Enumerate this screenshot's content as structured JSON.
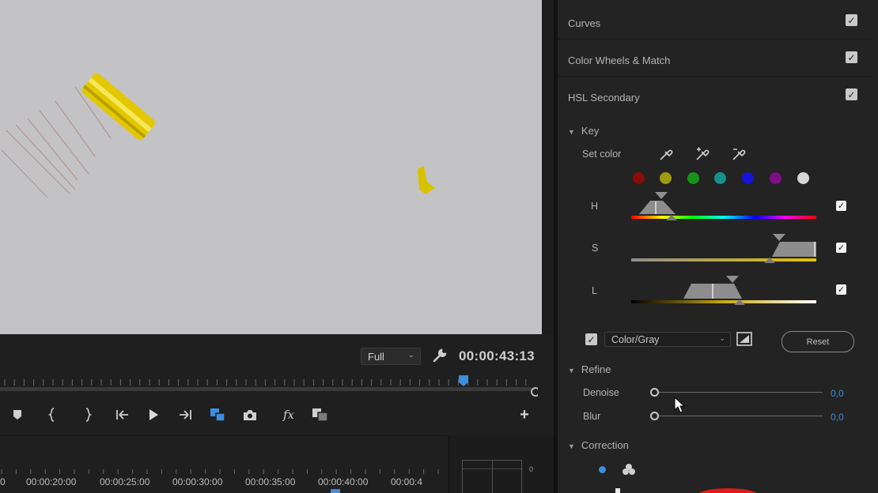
{
  "monitor": {
    "zoom": {
      "selected": "Full"
    },
    "timecode": "00:00:43:13"
  },
  "transport": {
    "buttons": [
      {
        "name": "add-marker-button",
        "icon": "marker-icon"
      },
      {
        "name": "mark-in-button",
        "icon": "mark-in-icon"
      },
      {
        "name": "mark-out-button",
        "icon": "mark-out-icon"
      },
      {
        "name": "go-to-in-button",
        "icon": "go-to-in-icon"
      },
      {
        "name": "play-button",
        "icon": "play-icon"
      },
      {
        "name": "go-to-out-button",
        "icon": "go-to-out-icon"
      },
      {
        "name": "comparison-view-button",
        "icon": "comparison-icon"
      },
      {
        "name": "export-frame-button",
        "icon": "camera-icon"
      },
      {
        "name": "fx-button",
        "icon": "fx-icon"
      },
      {
        "name": "multicam-button",
        "icon": "multicam-icon"
      },
      {
        "name": "add-button",
        "icon": "plus-icon"
      }
    ],
    "fx_label": "fx",
    "plus_label": "+"
  },
  "timeline": {
    "labels": [
      "0",
      "00:00:20:00",
      "00:00:25:00",
      "00:00:30:00",
      "00:00:35:00",
      "00:00:40:00",
      "00:00:4"
    ]
  },
  "meter": {
    "scale_label": "0"
  },
  "lumetri": {
    "sections": [
      {
        "title": "Curves",
        "checked": true
      },
      {
        "title": "Color Wheels & Match",
        "checked": true
      },
      {
        "title": "HSL Secondary",
        "checked": true
      }
    ],
    "key": {
      "heading": "Key",
      "set_color_label": "Set color",
      "swatch_colors": [
        "#8b0a0a",
        "#9e9a10",
        "#179417",
        "#14908f",
        "#1414d8",
        "#7c0f85",
        "#d6d6d6"
      ],
      "channels": [
        {
          "label": "H",
          "checked": true
        },
        {
          "label": "S",
          "checked": true
        },
        {
          "label": "L",
          "checked": true
        }
      ],
      "preview_checked": true,
      "preview_mode": "Color/Gray",
      "reset_label": "Reset"
    },
    "refine": {
      "heading": "Refine",
      "denoise": {
        "label": "Denoise",
        "value": "0,0"
      },
      "blur": {
        "label": "Blur",
        "value": "0,0"
      }
    },
    "correction": {
      "heading": "Correction"
    }
  }
}
